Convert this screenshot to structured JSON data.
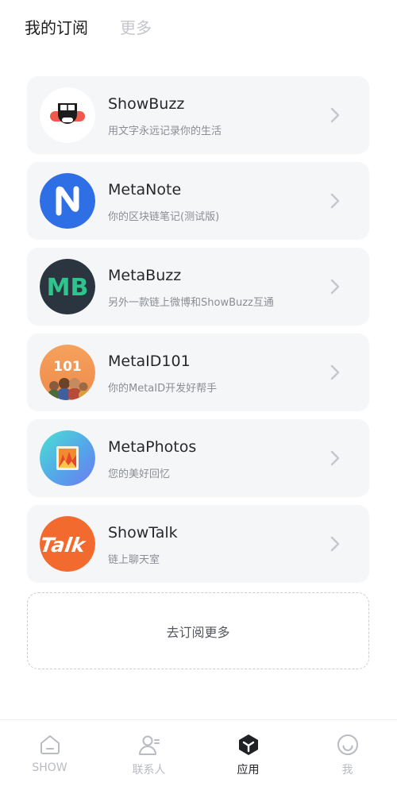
{
  "header": {
    "tabs": [
      {
        "label": "我的订阅",
        "active": true
      },
      {
        "label": "更多",
        "active": false
      }
    ]
  },
  "subscriptions": [
    {
      "title": "ShowBuzz",
      "subtitle": "用文字永远记录你的生活",
      "icon": "showbuzz-logo-icon"
    },
    {
      "title": "MetaNote",
      "subtitle": "你的区块链笔记(测试版)",
      "icon": "metanote-logo-icon"
    },
    {
      "title": "MetaBuzz",
      "subtitle": "另外一款链上微博和ShowBuzz互通",
      "icon": "metabuzz-logo-icon",
      "logo_text": "MB"
    },
    {
      "title": "MetaID101",
      "subtitle": "你的MetaID开发好帮手",
      "icon": "metaid101-logo-icon",
      "logo_text": "101"
    },
    {
      "title": "MetaPhotos",
      "subtitle": "您的美好回忆",
      "icon": "metaphotos-logo-icon"
    },
    {
      "title": "ShowTalk",
      "subtitle": "链上聊天室",
      "icon": "showtalk-logo-icon",
      "logo_text": "Talk"
    }
  ],
  "more_button": {
    "label": "去订阅更多"
  },
  "bottom_nav": [
    {
      "label": "SHOW",
      "icon": "home-icon",
      "active": false
    },
    {
      "label": "联系人",
      "icon": "contacts-icon",
      "active": false
    },
    {
      "label": "应用",
      "icon": "apps-icon",
      "active": true
    },
    {
      "label": "我",
      "icon": "smiley-icon",
      "active": false
    }
  ],
  "colors": {
    "card_bg": "#f5f6f8",
    "metanote_blue": "#2f6fe5",
    "metabuzz_dark": "#2b3540",
    "metabuzz_green": "#2fc48d",
    "metaid_orange": "#f3924f",
    "showtalk_orange": "#f26a2e",
    "showbuzz_red": "#ef5a4d"
  }
}
